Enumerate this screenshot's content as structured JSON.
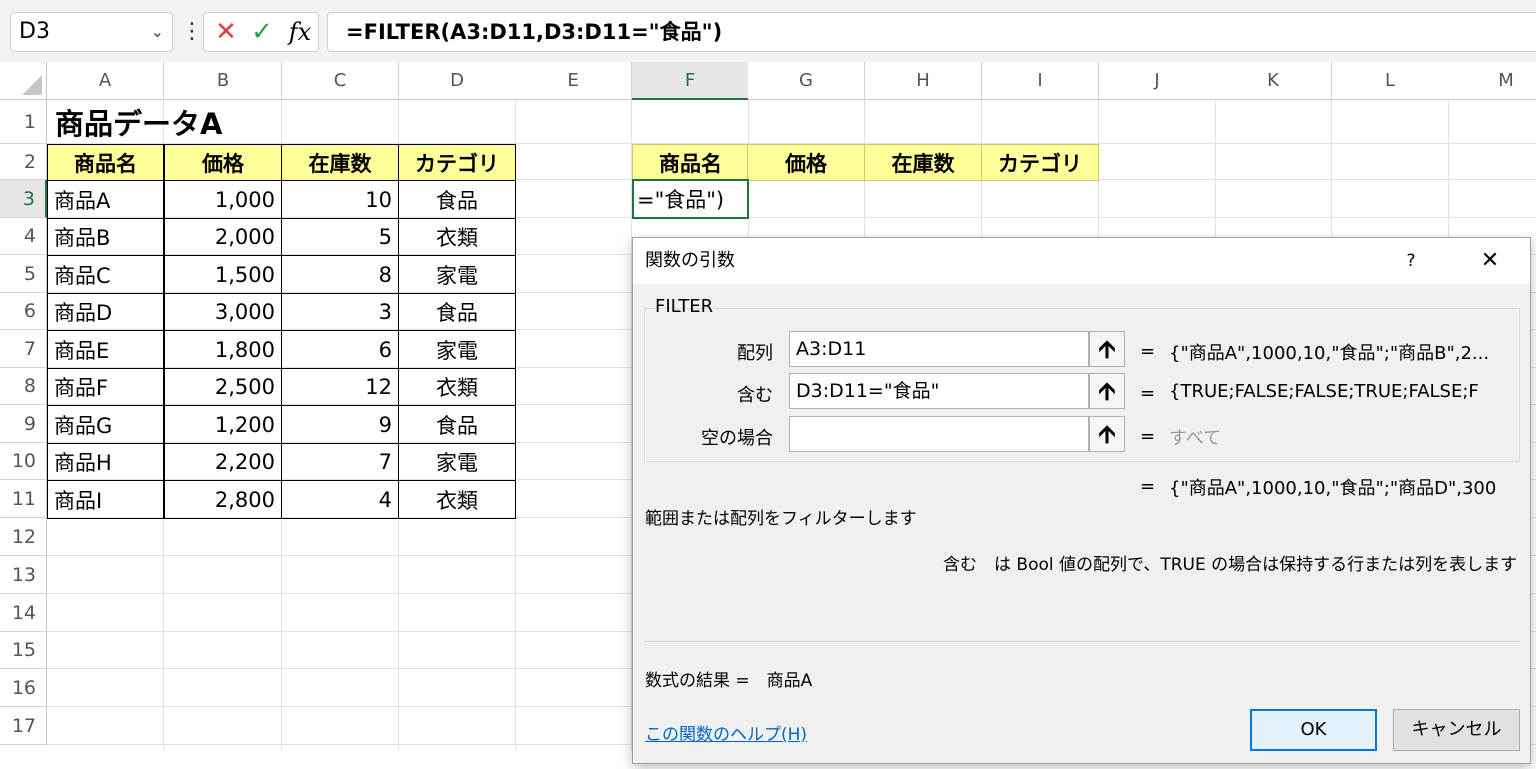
{
  "formula_bar": {
    "name_box": "D3",
    "cancel_icon": "✕",
    "enter_icon": "✓",
    "fx_label": "fx",
    "formula": "=FILTER(A3:D11,D3:D11=\"食品\")"
  },
  "columns": [
    "A",
    "B",
    "C",
    "D",
    "E",
    "F",
    "G",
    "H",
    "I",
    "J",
    "K",
    "L",
    "M"
  ],
  "rows": [
    "1",
    "2",
    "3",
    "4",
    "5",
    "6",
    "7",
    "8",
    "9",
    "10",
    "11",
    "12",
    "13",
    "14",
    "15",
    "16",
    "17"
  ],
  "sheet": {
    "title": "商品データA",
    "headers": [
      "商品名",
      "価格",
      "在庫数",
      "カテゴリ"
    ],
    "data": [
      [
        "商品A",
        "1,000",
        "10",
        "食品"
      ],
      [
        "商品B",
        "2,000",
        "5",
        "衣類"
      ],
      [
        "商品C",
        "1,500",
        "8",
        "家電"
      ],
      [
        "商品D",
        "3,000",
        "3",
        "食品"
      ],
      [
        "商品E",
        "1,800",
        "6",
        "家電"
      ],
      [
        "商品F",
        "2,500",
        "12",
        "衣類"
      ],
      [
        "商品G",
        "1,200",
        "9",
        "食品"
      ],
      [
        "商品H",
        "2,200",
        "7",
        "家電"
      ],
      [
        "商品I",
        "2,800",
        "4",
        "衣類"
      ]
    ],
    "result_headers": [
      "商品名",
      "価格",
      "在庫数",
      "カテゴリ"
    ],
    "editing_cell_text": "=\"食品\")"
  },
  "dialog": {
    "title": "関数の引数",
    "help_icon": "?",
    "close_icon": "✕",
    "function_name": "FILTER",
    "args": [
      {
        "label": "配列",
        "value": "A3:D11",
        "eq": "=",
        "result": "{\"商品A\",1000,10,\"食品\";\"商品B\",2..."
      },
      {
        "label": "含む",
        "value": "D3:D11=\"食品\"",
        "eq": "=",
        "result": "{TRUE;FALSE;FALSE;TRUE;FALSE;F"
      },
      {
        "label": "空の場合",
        "value": "",
        "eq": "=",
        "result": "すべて"
      }
    ],
    "overall_eq": "=",
    "overall_result": "{\"商品A\",1000,10,\"食品\";\"商品D\",300",
    "description": "範囲または配列をフィルターします",
    "arg_description": "含む　は Bool 値の配列で、TRUE の場合は保持する行または列を表します",
    "formula_result": "数式の結果 =　商品A",
    "help_link": "この関数のヘルプ(H)",
    "ok_label": "OK",
    "cancel_label": "キャンセル"
  }
}
